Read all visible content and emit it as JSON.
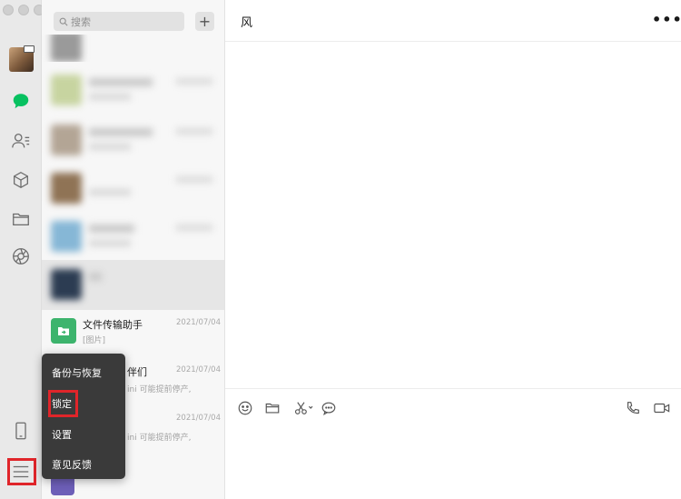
{
  "sidebar": {
    "icons": [
      "chat-icon",
      "contacts-icon",
      "favorites-icon",
      "files-icon",
      "moments-icon",
      "phone-icon",
      "menu-icon"
    ]
  },
  "chat_list": {
    "search_placeholder": "搜索",
    "add_label": "+",
    "visible_chats": [
      {
        "name": "文件传输助手",
        "preview": "[图片]",
        "time": "2021/07/04"
      },
      {
        "name": "伴们",
        "preview": "ini 可能提前停产,",
        "time": "2021/07/04"
      },
      {
        "name": "",
        "preview": "ini 可能提前停产,",
        "time": "2021/07/04"
      }
    ]
  },
  "menu": {
    "items": [
      "备份与恢复",
      "锁定",
      "设置",
      "意见反馈"
    ]
  },
  "conversation": {
    "title": "风",
    "more_label": "•••"
  },
  "toolbar": {
    "icons": [
      "emoji-icon",
      "folder-icon",
      "scissors-icon",
      "chat-bubble-icon",
      "phone-call-icon",
      "video-call-icon"
    ]
  },
  "colors": {
    "accent_green": "#07c160",
    "highlight_red": "#e0252a",
    "menu_bg": "#3a3a3a"
  }
}
